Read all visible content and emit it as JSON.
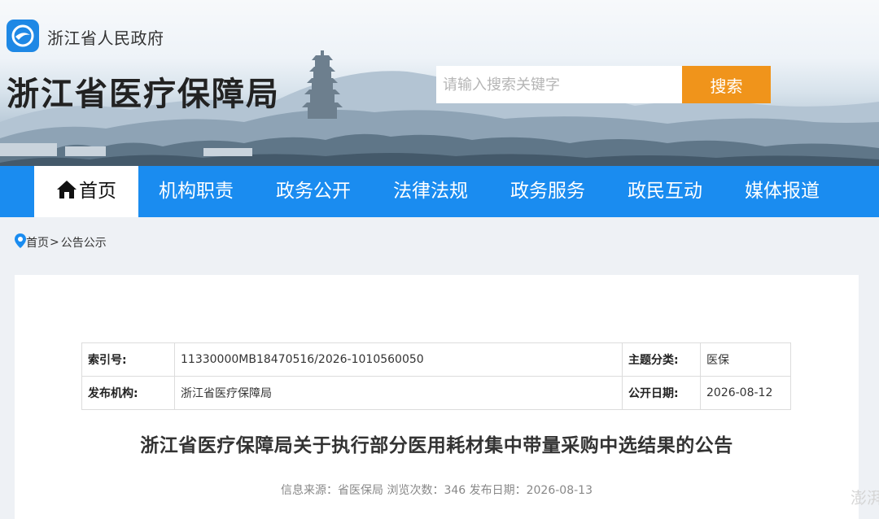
{
  "header": {
    "gov_name": "浙江省人民政府",
    "bureau_title": "浙江省医疗保障局",
    "search": {
      "placeholder": "请输入搜索关键字",
      "button_label": "搜索"
    }
  },
  "nav": {
    "items": [
      {
        "label": "首页",
        "icon": "home-icon",
        "active": true
      },
      {
        "label": "机构职责"
      },
      {
        "label": "政务公开"
      },
      {
        "label": "法律法规"
      },
      {
        "label": "政务服务"
      },
      {
        "label": "政民互动"
      },
      {
        "label": "媒体报道"
      }
    ],
    "color": "#1a8cf0"
  },
  "breadcrumb": {
    "home": "首页",
    "separator": ">",
    "current": "公告公示"
  },
  "meta_table": {
    "index_label": "索引号:",
    "index_value": "11330000MB18470516/2026-1010560050",
    "topic_label": "主题分类:",
    "topic_value": "医保",
    "publisher_label": "发布机构:",
    "publisher_value": "浙江省医疗保障局",
    "date_label": "公开日期:",
    "date_value": "2026-08-12"
  },
  "article": {
    "title": "浙江省医疗保障局关于执行部分医用耗材集中带量采购中选结果的公告",
    "info": "信息来源：省医保局 浏览次数：346 发布日期：2026-08-13"
  },
  "watermark": "澎湃",
  "colors": {
    "search_button": "#f0941b",
    "nav_bar": "#1a8cf0"
  }
}
